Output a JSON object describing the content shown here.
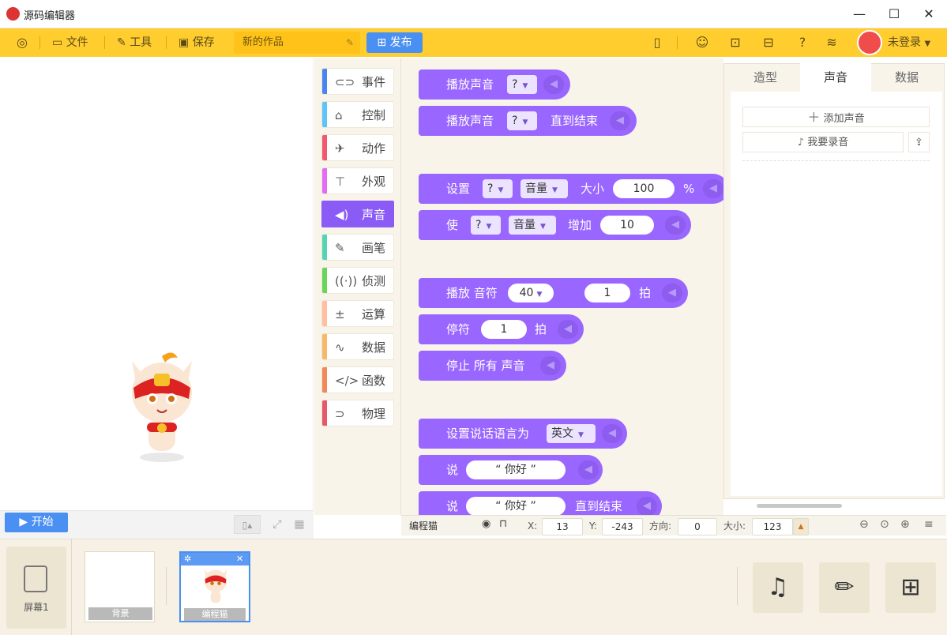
{
  "window": {
    "title": "源码编辑器",
    "minimize": "—",
    "maximize": "☐",
    "close": "✕"
  },
  "toolbar": {
    "file": "文件",
    "tools": "工具",
    "save": "保存",
    "project_name": "新的作品",
    "publish": "发布",
    "login": "未登录"
  },
  "stage": {
    "start": "开始"
  },
  "categories": [
    {
      "label": "事件",
      "color": "#4a86f0",
      "icon": "toggle-icon"
    },
    {
      "label": "控制",
      "color": "#5ec6f7",
      "icon": "gamepad-icon"
    },
    {
      "label": "动作",
      "color": "#f05a6a",
      "icon": "running-icon"
    },
    {
      "label": "外观",
      "color": "#e26df2",
      "icon": "shirt-icon"
    },
    {
      "label": "声音",
      "color": "#8a5cf5",
      "icon": "speaker-icon"
    },
    {
      "label": "画笔",
      "color": "#54d6b6",
      "icon": "pencil-icon"
    },
    {
      "label": "侦测",
      "color": "#6ad55a",
      "icon": "sensor-icon"
    },
    {
      "label": "运算",
      "color": "#ffbfa0",
      "icon": "calculator-icon"
    },
    {
      "label": "数据",
      "color": "#f6b96a",
      "icon": "chart-icon"
    },
    {
      "label": "函数",
      "color": "#f08a5a",
      "icon": "function-icon"
    },
    {
      "label": "物理",
      "color": "#e65a68",
      "icon": "magnet-icon"
    }
  ],
  "blocks": {
    "play_sound": "播放声音",
    "play_sound_until": "播放声音",
    "until_end": "直到结束",
    "q": "?",
    "set": "设置",
    "volume": "音量",
    "size": "大小",
    "vol_value": "100",
    "percent": "%",
    "change": "使",
    "increase": "增加",
    "inc_value": "10",
    "play_note": "播放 音符",
    "note_value": "40",
    "beat_value": "1",
    "beat": "拍",
    "rest": "停符",
    "rest_value": "1",
    "rest_beat": "拍",
    "stop_all": "停止 所有 声音",
    "set_lang": "设置说话语言为",
    "lang": "英文",
    "say": "说",
    "hello": "你好",
    "say2": "说",
    "hello2": "你好",
    "say_until": "直到结束"
  },
  "rightpanel": {
    "tabs": [
      "造型",
      "声音",
      "数据"
    ],
    "add_sound": "添加声音",
    "record": "我要录音"
  },
  "status": {
    "sprite": "编程猫",
    "x_label": "X:",
    "x": "13",
    "y_label": "Y:",
    "y": "-243",
    "dir_label": "方向:",
    "dir": "0",
    "size_label": "大小:",
    "size": "123"
  },
  "bottom": {
    "screen": "屏幕1",
    "background": "背景",
    "sprite": "编程猫"
  }
}
